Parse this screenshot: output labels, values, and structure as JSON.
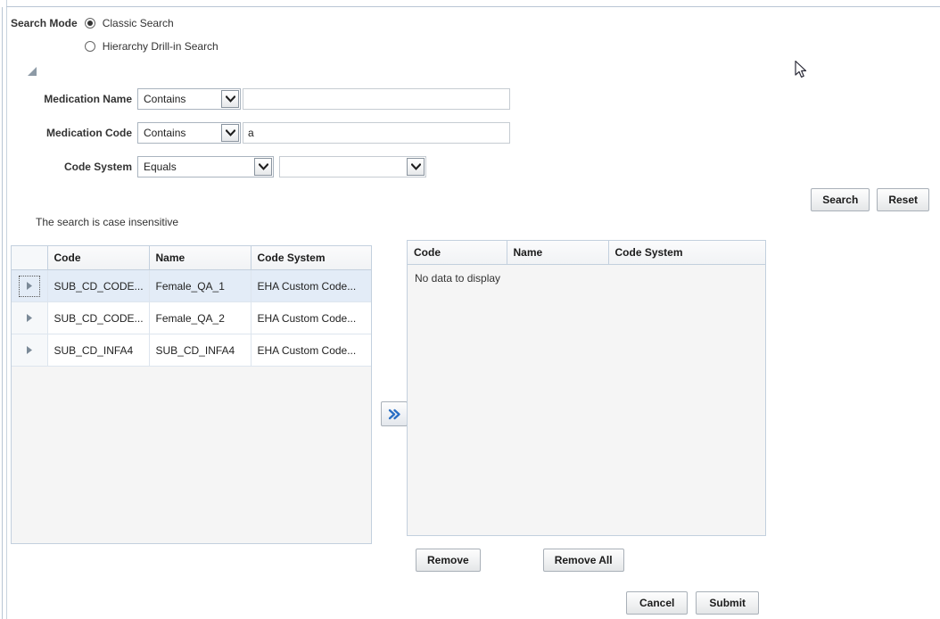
{
  "search_mode": {
    "label": "Search Mode",
    "options": [
      {
        "label": "Classic Search",
        "selected": true
      },
      {
        "label": "Hierarchy Drill-in Search",
        "selected": false
      }
    ]
  },
  "disclosure": {
    "icon": "collapse-triangle-icon"
  },
  "criteria": [
    {
      "label": "Medication Name",
      "operator": "Contains",
      "operator_icon": "chevron-down-icon",
      "value": "",
      "value_kind": "text"
    },
    {
      "label": "Medication Code",
      "operator": "Contains",
      "operator_icon": "chevron-down-icon",
      "value": "a",
      "value_kind": "text"
    },
    {
      "label": "Code System",
      "operator": "Equals",
      "operator_icon": "chevron-down-icon",
      "value": "",
      "value_kind": "select",
      "value_icon": "chevron-down-icon"
    }
  ],
  "actions": {
    "search_label": "Search",
    "reset_label": "Reset"
  },
  "hint": "The search is case insensitive",
  "results_table": {
    "columns": [
      "",
      "Code",
      "Name",
      "Code System"
    ],
    "rows": [
      {
        "handle_icon": "row-expand-arrow-icon",
        "code": "SUB_CD_CODE...",
        "name": "Female_QA_1",
        "code_system": "EHA Custom Code...",
        "selected": true
      },
      {
        "handle_icon": "row-expand-arrow-icon",
        "code": "SUB_CD_CODE...",
        "name": "Female_QA_2",
        "code_system": "EHA Custom Code...",
        "selected": false
      },
      {
        "handle_icon": "row-expand-arrow-icon",
        "code": "SUB_CD_INFA4",
        "name": "SUB_CD_INFA4",
        "code_system": "EHA Custom Code...",
        "selected": false
      }
    ]
  },
  "selected_table": {
    "columns": [
      "Code",
      "Name",
      "Code System"
    ],
    "empty_text": "No data to display",
    "rows": []
  },
  "transfer": {
    "label": "",
    "icon": "double-chevron-right-icon",
    "accent": "#2a6fc4"
  },
  "selected_actions": {
    "remove_label": "Remove",
    "remove_all_label": "Remove All"
  },
  "footer": {
    "cancel_label": "Cancel",
    "submit_label": "Submit"
  },
  "cursor": {
    "icon": "mouse-pointer-icon"
  }
}
